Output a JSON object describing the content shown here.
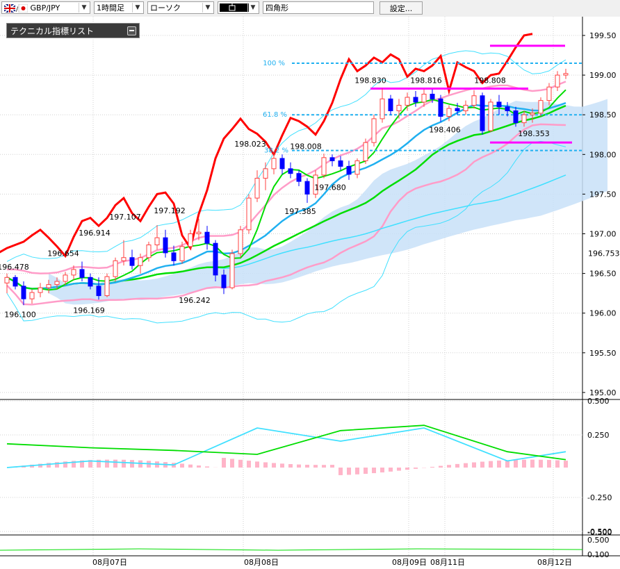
{
  "toolbar": {
    "pair": "GBP/JPY",
    "timeframe": "1時間足",
    "chart_style": "ローソク",
    "draw_tool_color": "#000000",
    "draw_tool_shape": "四角形",
    "settings_label": "設定..."
  },
  "indicator_list_label": "テクニカル指標リスト",
  "colors": {
    "up_candle": "#ff4040",
    "down_candle": "#0000ff",
    "price_line": "#ff0000",
    "cloud": "#c8e0f8",
    "ma_green": "#00dd00",
    "ma_blue": "#20b0f0",
    "ma_cyan": "#40e0ff",
    "bollinger_pink": "#ff9cc8",
    "fib_line": "#20b0f0",
    "range_box": "#ff00ff"
  },
  "chart_data": [
    {
      "type": "candlestick",
      "price_axis_ticks": [
        "199.50",
        "199.00",
        "198.50",
        "198.00",
        "197.50",
        "197.00",
        "196.50",
        "196.00",
        "195.50",
        "195.00"
      ],
      "current_price_label": "196.753",
      "ylim": [
        195.0,
        199.5
      ],
      "x_date_labels": [
        "08月07日",
        "08月08日",
        "08月09日",
        "08月11日",
        "08月12日"
      ],
      "fibonacci": [
        {
          "label": "100 %",
          "price": 199.15
        },
        {
          "label": "61.8 %",
          "price": 198.5
        },
        {
          "label": "38.2 %",
          "price": 198.05
        }
      ],
      "annotations": [
        "196.478",
        "196.100",
        "196.654",
        "196.914",
        "196.169",
        "197.107",
        "197.192",
        "196.242",
        "198.023",
        "198.008",
        "197.385",
        "197.680",
        "198.830",
        "198.816",
        "198.406",
        "198.808",
        "198.353"
      ],
      "candles": [
        {
          "o": 196.38,
          "h": 196.5,
          "l": 196.25,
          "c": 196.45
        },
        {
          "o": 196.45,
          "h": 196.48,
          "l": 196.3,
          "c": 196.34
        },
        {
          "o": 196.34,
          "h": 196.4,
          "l": 196.1,
          "c": 196.18
        },
        {
          "o": 196.18,
          "h": 196.3,
          "l": 196.12,
          "c": 196.26
        },
        {
          "o": 196.26,
          "h": 196.38,
          "l": 196.2,
          "c": 196.32
        },
        {
          "o": 196.32,
          "h": 196.42,
          "l": 196.25,
          "c": 196.36
        },
        {
          "o": 196.36,
          "h": 196.45,
          "l": 196.3,
          "c": 196.4
        },
        {
          "o": 196.4,
          "h": 196.52,
          "l": 196.35,
          "c": 196.48
        },
        {
          "o": 196.48,
          "h": 196.6,
          "l": 196.42,
          "c": 196.55
        },
        {
          "o": 196.55,
          "h": 196.65,
          "l": 196.4,
          "c": 196.45
        },
        {
          "o": 196.45,
          "h": 196.5,
          "l": 196.3,
          "c": 196.34
        },
        {
          "o": 196.34,
          "h": 196.45,
          "l": 196.17,
          "c": 196.22
        },
        {
          "o": 196.22,
          "h": 196.5,
          "l": 196.2,
          "c": 196.46
        },
        {
          "o": 196.46,
          "h": 196.7,
          "l": 196.4,
          "c": 196.66
        },
        {
          "o": 196.66,
          "h": 196.92,
          "l": 196.6,
          "c": 196.7
        },
        {
          "o": 196.7,
          "h": 196.8,
          "l": 196.55,
          "c": 196.6
        },
        {
          "o": 196.6,
          "h": 196.75,
          "l": 196.5,
          "c": 196.7
        },
        {
          "o": 196.7,
          "h": 196.9,
          "l": 196.65,
          "c": 196.86
        },
        {
          "o": 196.86,
          "h": 197.11,
          "l": 196.8,
          "c": 196.95
        },
        {
          "o": 196.95,
          "h": 197.05,
          "l": 196.7,
          "c": 196.76
        },
        {
          "o": 196.76,
          "h": 196.85,
          "l": 196.6,
          "c": 196.66
        },
        {
          "o": 196.66,
          "h": 196.9,
          "l": 196.62,
          "c": 196.84
        },
        {
          "o": 196.84,
          "h": 197.05,
          "l": 196.8,
          "c": 197.0
        },
        {
          "o": 197.0,
          "h": 197.19,
          "l": 196.92,
          "c": 197.02
        },
        {
          "o": 197.02,
          "h": 197.1,
          "l": 196.8,
          "c": 196.88
        },
        {
          "o": 196.88,
          "h": 196.92,
          "l": 196.4,
          "c": 196.48
        },
        {
          "o": 196.48,
          "h": 196.55,
          "l": 196.24,
          "c": 196.32
        },
        {
          "o": 196.32,
          "h": 196.8,
          "l": 196.3,
          "c": 196.75
        },
        {
          "o": 196.75,
          "h": 197.1,
          "l": 196.7,
          "c": 197.05
        },
        {
          "o": 197.05,
          "h": 197.5,
          "l": 197.0,
          "c": 197.45
        },
        {
          "o": 197.45,
          "h": 197.8,
          "l": 197.4,
          "c": 197.7
        },
        {
          "o": 197.7,
          "h": 197.9,
          "l": 197.55,
          "c": 197.82
        },
        {
          "o": 197.82,
          "h": 198.02,
          "l": 197.75,
          "c": 197.95
        },
        {
          "o": 197.95,
          "h": 198.0,
          "l": 197.75,
          "c": 197.82
        },
        {
          "o": 197.82,
          "h": 197.9,
          "l": 197.7,
          "c": 197.76
        },
        {
          "o": 197.76,
          "h": 197.8,
          "l": 197.6,
          "c": 197.66
        },
        {
          "o": 197.66,
          "h": 197.7,
          "l": 197.39,
          "c": 197.5
        },
        {
          "o": 197.5,
          "h": 197.8,
          "l": 197.45,
          "c": 197.74
        },
        {
          "o": 197.74,
          "h": 198.01,
          "l": 197.7,
          "c": 197.96
        },
        {
          "o": 197.96,
          "h": 198.0,
          "l": 197.85,
          "c": 197.92
        },
        {
          "o": 197.92,
          "h": 197.98,
          "l": 197.8,
          "c": 197.85
        },
        {
          "o": 197.85,
          "h": 197.92,
          "l": 197.68,
          "c": 197.75
        },
        {
          "o": 197.75,
          "h": 197.95,
          "l": 197.7,
          "c": 197.92
        },
        {
          "o": 197.92,
          "h": 198.2,
          "l": 197.88,
          "c": 198.15
        },
        {
          "o": 198.15,
          "h": 198.5,
          "l": 198.1,
          "c": 198.45
        },
        {
          "o": 198.45,
          "h": 198.83,
          "l": 198.4,
          "c": 198.7
        },
        {
          "o": 198.7,
          "h": 198.75,
          "l": 198.5,
          "c": 198.55
        },
        {
          "o": 198.55,
          "h": 198.7,
          "l": 198.45,
          "c": 198.62
        },
        {
          "o": 198.62,
          "h": 198.78,
          "l": 198.55,
          "c": 198.72
        },
        {
          "o": 198.72,
          "h": 198.8,
          "l": 198.6,
          "c": 198.66
        },
        {
          "o": 198.66,
          "h": 198.82,
          "l": 198.6,
          "c": 198.76
        },
        {
          "o": 198.76,
          "h": 198.82,
          "l": 198.65,
          "c": 198.7
        },
        {
          "o": 198.7,
          "h": 198.75,
          "l": 198.41,
          "c": 198.48
        },
        {
          "o": 198.48,
          "h": 198.62,
          "l": 198.42,
          "c": 198.58
        },
        {
          "o": 198.58,
          "h": 198.65,
          "l": 198.5,
          "c": 198.55
        },
        {
          "o": 198.55,
          "h": 198.68,
          "l": 198.5,
          "c": 198.62
        },
        {
          "o": 198.62,
          "h": 198.81,
          "l": 198.58,
          "c": 198.74
        },
        {
          "o": 198.74,
          "h": 198.78,
          "l": 198.25,
          "c": 198.3
        },
        {
          "o": 198.3,
          "h": 198.7,
          "l": 198.28,
          "c": 198.66
        },
        {
          "o": 198.66,
          "h": 198.75,
          "l": 198.5,
          "c": 198.6
        },
        {
          "o": 198.6,
          "h": 198.66,
          "l": 198.48,
          "c": 198.55
        },
        {
          "o": 198.55,
          "h": 198.6,
          "l": 198.35,
          "c": 198.4
        },
        {
          "o": 198.4,
          "h": 198.55,
          "l": 198.35,
          "c": 198.5
        },
        {
          "o": 198.5,
          "h": 198.58,
          "l": 198.4,
          "c": 198.52
        },
        {
          "o": 198.52,
          "h": 198.72,
          "l": 198.48,
          "c": 198.68
        },
        {
          "o": 198.68,
          "h": 198.9,
          "l": 198.62,
          "c": 198.85
        },
        {
          "o": 198.85,
          "h": 199.05,
          "l": 198.8,
          "c": 199.0
        },
        {
          "o": 199.0,
          "h": 199.08,
          "l": 198.95,
          "c": 199.02
        }
      ]
    },
    {
      "type": "line",
      "title": "",
      "ylim": [
        -0.55,
        0.55
      ],
      "y_ticks": [
        "0.500",
        "0.250",
        "-0.250",
        "-0.500"
      ],
      "x": [
        0,
        10,
        20,
        30,
        40,
        50,
        60,
        67
      ],
      "series": [
        {
          "color": "#40e0ff",
          "values": [
            0.0,
            0.05,
            0.02,
            0.3,
            0.2,
            0.3,
            0.05,
            0.12
          ]
        },
        {
          "color": "#00dd00",
          "values": [
            0.18,
            0.15,
            0.13,
            0.1,
            0.28,
            0.32,
            0.12,
            0.06
          ]
        }
      ]
    },
    {
      "type": "line",
      "y_ticks": [
        "-0.500",
        "0.500",
        "0.100"
      ]
    }
  ]
}
